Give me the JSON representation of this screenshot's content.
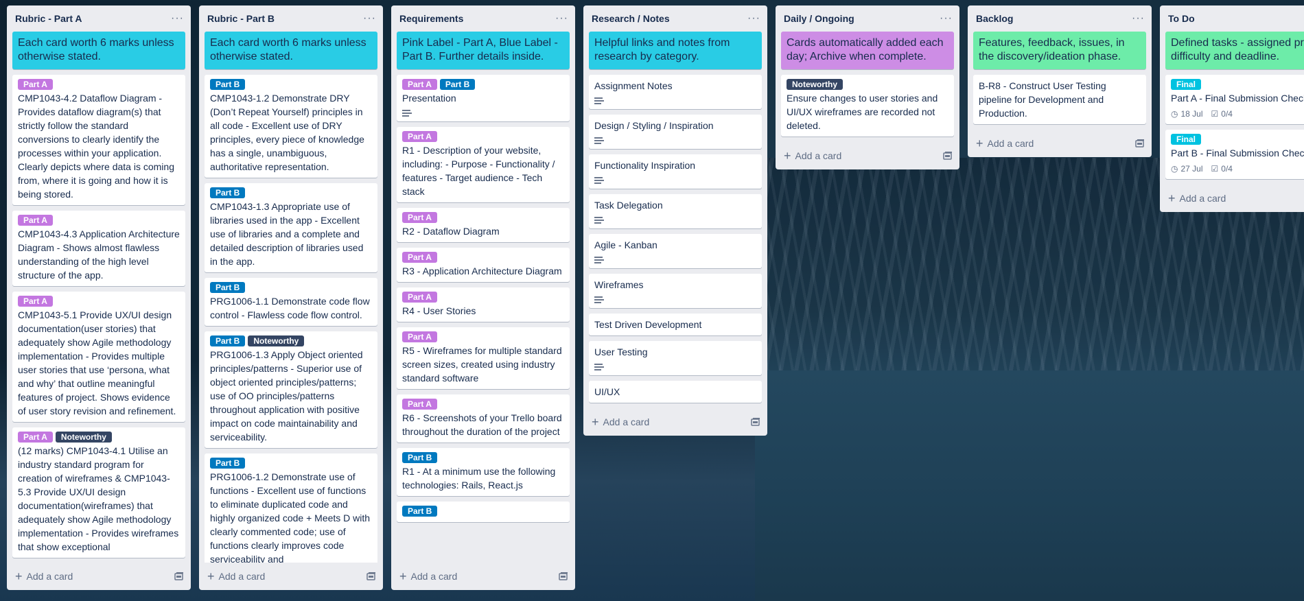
{
  "lists": [
    {
      "title": "Rubric - Part A",
      "cover": {
        "text": "Each card worth 6 marks unless otherwise stated.",
        "color": "#29cce5"
      },
      "cards": [
        {
          "labels": [
            {
              "text": "Part A",
              "color": "purple"
            }
          ],
          "text": "CMP1043-4.2 Dataflow Diagram - Provides dataflow diagram(s) that strictly follow the standard conversions to clearly identify the processes within your application. Clearly depicts where data is coming from, where it is going and how it is being stored."
        },
        {
          "labels": [
            {
              "text": "Part A",
              "color": "purple"
            }
          ],
          "text": "CMP1043-4.3 Application Architecture Diagram - Shows almost flawless understanding of the high level structure of the app."
        },
        {
          "labels": [
            {
              "text": "Part A",
              "color": "purple"
            }
          ],
          "text": "CMP1043-5.1 Provide UX/UI design documentation(user stories) that adequately show Agile methodology implementation - Provides multiple user stories that use ‘persona, what and why’ that outline meaningful features of project. Shows evidence of user story revision and refinement."
        },
        {
          "labels": [
            {
              "text": "Part A",
              "color": "purple"
            },
            {
              "text": "Noteworthy",
              "color": "dark"
            }
          ],
          "text": "(12 marks) CMP1043-4.1 Utilise an industry standard program for creation of wireframes & CMP1043-5.3 Provide UX/UI design documentation(wireframes) that adequately show Agile methodology implementation - Provides wireframes that show exceptional"
        }
      ],
      "add_label": "Add a card"
    },
    {
      "title": "Rubric - Part B",
      "cover": {
        "text": "Each card worth 6 marks unless otherwise stated.",
        "color": "#29cce5"
      },
      "cards": [
        {
          "labels": [
            {
              "text": "Part B",
              "color": "blue"
            }
          ],
          "text": "CMP1043-1.2 Demonstrate DRY (Don’t Repeat Yourself) principles in all code - Excellent use of DRY principles, every piece of knowledge has a single, unambiguous, authoritative representation."
        },
        {
          "labels": [
            {
              "text": "Part B",
              "color": "blue"
            }
          ],
          "text": "CMP1043-1.3 Appropriate use of libraries used in the app - Excellent use of libraries and a complete and detailed description of libraries used in the app."
        },
        {
          "labels": [
            {
              "text": "Part B",
              "color": "blue"
            }
          ],
          "text": "PRG1006-1.1 Demonstrate code flow control - Flawless code flow control."
        },
        {
          "labels": [
            {
              "text": "Part B",
              "color": "blue"
            },
            {
              "text": "Noteworthy",
              "color": "dark"
            }
          ],
          "text": "PRG1006-1.3 Apply Object oriented principles/patterns - Superior use of object oriented principles/patterns; use of OO principles/patterns throughout application with positive impact on code maintainability and serviceability."
        },
        {
          "labels": [
            {
              "text": "Part B",
              "color": "blue"
            }
          ],
          "text": "PRG1006-1.2 Demonstrate use of functions - Excellent use of functions to eliminate duplicated code and highly organized code + Meets D with clearly commented code; use of functions clearly improves code serviceability and"
        }
      ],
      "add_label": "Add a card"
    },
    {
      "title": "Requirements",
      "cover": {
        "text": "Pink Label - Part A, Blue Label - Part B. Further details inside.",
        "color": "#29cce5"
      },
      "cards": [
        {
          "labels": [
            {
              "text": "Part A",
              "color": "purple"
            },
            {
              "text": "Part B",
              "color": "blue"
            }
          ],
          "text": "Presentation",
          "desc": true
        },
        {
          "labels": [
            {
              "text": "Part A",
              "color": "purple"
            }
          ],
          "text": "R1 - Description of your website, including: - Purpose - Functionality / features - Target audience - Tech stack"
        },
        {
          "labels": [
            {
              "text": "Part A",
              "color": "purple"
            }
          ],
          "text": "R2 - Dataflow Diagram"
        },
        {
          "labels": [
            {
              "text": "Part A",
              "color": "purple"
            }
          ],
          "text": "R3 - Application Architecture Diagram"
        },
        {
          "labels": [
            {
              "text": "Part A",
              "color": "purple"
            }
          ],
          "text": "R4 - User Stories"
        },
        {
          "labels": [
            {
              "text": "Part A",
              "color": "purple"
            }
          ],
          "text": "R5 - Wireframes for multiple standard screen sizes, created using industry standard software"
        },
        {
          "labels": [
            {
              "text": "Part A",
              "color": "purple"
            }
          ],
          "text": "R6 - Screenshots of your Trello board throughout the duration of the project"
        },
        {
          "labels": [
            {
              "text": "Part B",
              "color": "blue"
            }
          ],
          "text": "R1 - At a minimum use the following technologies: Rails, React.js"
        },
        {
          "labels": [
            {
              "text": "Part B",
              "color": "blue"
            }
          ],
          "text": ""
        }
      ],
      "add_label": "Add a card"
    },
    {
      "title": "Research / Notes",
      "cover": {
        "text": "Helpful links and notes from research by category.",
        "color": "#29cce5"
      },
      "cards": [
        {
          "labels": [],
          "text": "Assignment Notes",
          "desc": true
        },
        {
          "labels": [],
          "text": "Design / Styling / Inspiration",
          "desc": true
        },
        {
          "labels": [],
          "text": "Functionality Inspiration",
          "desc": true
        },
        {
          "labels": [],
          "text": "Task Delegation",
          "desc": true
        },
        {
          "labels": [],
          "text": "Agile - Kanban",
          "desc": true
        },
        {
          "labels": [],
          "text": "Wireframes",
          "desc": true
        },
        {
          "labels": [],
          "text": "Test Driven Development"
        },
        {
          "labels": [],
          "text": "User Testing",
          "desc": true
        },
        {
          "labels": [],
          "text": "UI/UX"
        }
      ],
      "add_label": "Add a card"
    },
    {
      "title": "Daily / Ongoing",
      "cover": {
        "text": "Cards automatically added each day; Archive when complete.",
        "color": "#cd8de5"
      },
      "cards": [
        {
          "labels": [
            {
              "text": "Noteworthy",
              "color": "dark"
            }
          ],
          "text": "Ensure changes to user stories and UI/UX wireframes are recorded not deleted."
        }
      ],
      "add_label": "Add a card"
    },
    {
      "title": "Backlog",
      "cover": {
        "text": "Features, feedback, issues, in the discovery/ideation phase.",
        "color": "#6deca9"
      },
      "cards": [
        {
          "labels": [],
          "text": "B-R8 - Construct User Testing pipeline for Development and Production."
        }
      ],
      "add_label": "Add a card"
    },
    {
      "title": "To Do",
      "cover": {
        "text": "Defined tasks - assigned priority, difficulty and deadline.",
        "color": "#6deca9"
      },
      "cards": [
        {
          "labels": [
            {
              "text": "Final",
              "color": "cyan"
            }
          ],
          "text": "Part A - Final Submission Checklist",
          "due": "18 Jul",
          "checklist": "0/4"
        },
        {
          "labels": [
            {
              "text": "Final",
              "color": "cyan"
            }
          ],
          "text": "Part B - Final Submission Checklist",
          "due": "27 Jul",
          "checklist": "0/4"
        }
      ],
      "add_label": "Add a card"
    }
  ],
  "icons": {
    "menu": "ellipsis-icon",
    "add": "plus-icon",
    "template": "card-template-icon",
    "description": "description-icon",
    "clock": "clock-icon",
    "checklist": "checklist-icon"
  }
}
